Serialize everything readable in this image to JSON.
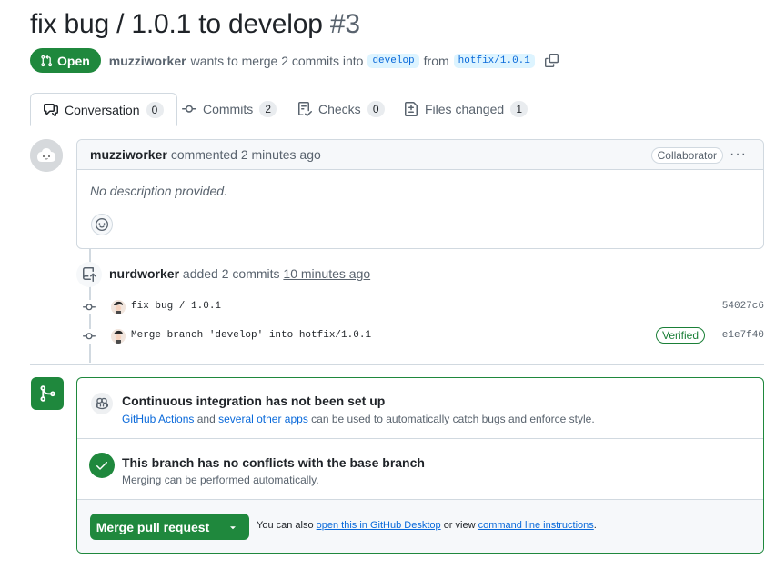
{
  "pr": {
    "title": "fix bug / 1.0.1 to develop",
    "number": "#3",
    "state": "Open",
    "author": "muzziworker",
    "merge_text": "wants to merge 2 commits into",
    "base_branch": "develop",
    "from_text": "from",
    "head_branch": "hotfix/1.0.1"
  },
  "tabs": [
    {
      "label": "Conversation",
      "count": "0",
      "icon": "comment-discussion-icon"
    },
    {
      "label": "Commits",
      "count": "2",
      "icon": "git-commit-icon"
    },
    {
      "label": "Checks",
      "count": "0",
      "icon": "checklist-icon"
    },
    {
      "label": "Files changed",
      "count": "1",
      "icon": "file-diff-icon"
    }
  ],
  "comment": {
    "author": "muzziworker",
    "action": "commented 2 minutes ago",
    "role": "Collaborator",
    "menu": "···",
    "body": "No description provided."
  },
  "timeline_event": {
    "actor": "nurdworker",
    "action": "added 2 commits",
    "time": "10 minutes ago"
  },
  "commits": [
    {
      "message": "fix bug / 1.0.1",
      "sha": "54027c6",
      "verified": ""
    },
    {
      "message": "Merge branch 'develop' into hotfix/1.0.1",
      "sha": "e1e7f40",
      "verified": "Verified"
    }
  ],
  "merge_box": {
    "ci_title": "Continuous integration has not been set up",
    "ci_link1": "GitHub Actions",
    "ci_and": "and",
    "ci_link2": "several other apps",
    "ci_rest": "can be used to automatically catch bugs and enforce style.",
    "conflict_title": "This branch has no conflicts with the base branch",
    "conflict_sub": "Merging can be performed automatically.",
    "merge_button": "Merge pull request",
    "footer_prefix": "You can also",
    "footer_link1": "open this in GitHub Desktop",
    "footer_mid": "or view",
    "footer_link2": "command line instructions",
    "footer_end": "."
  },
  "colors": {
    "accent_green": "#1f883d",
    "link_blue": "#0969da",
    "muted": "#59636e"
  }
}
